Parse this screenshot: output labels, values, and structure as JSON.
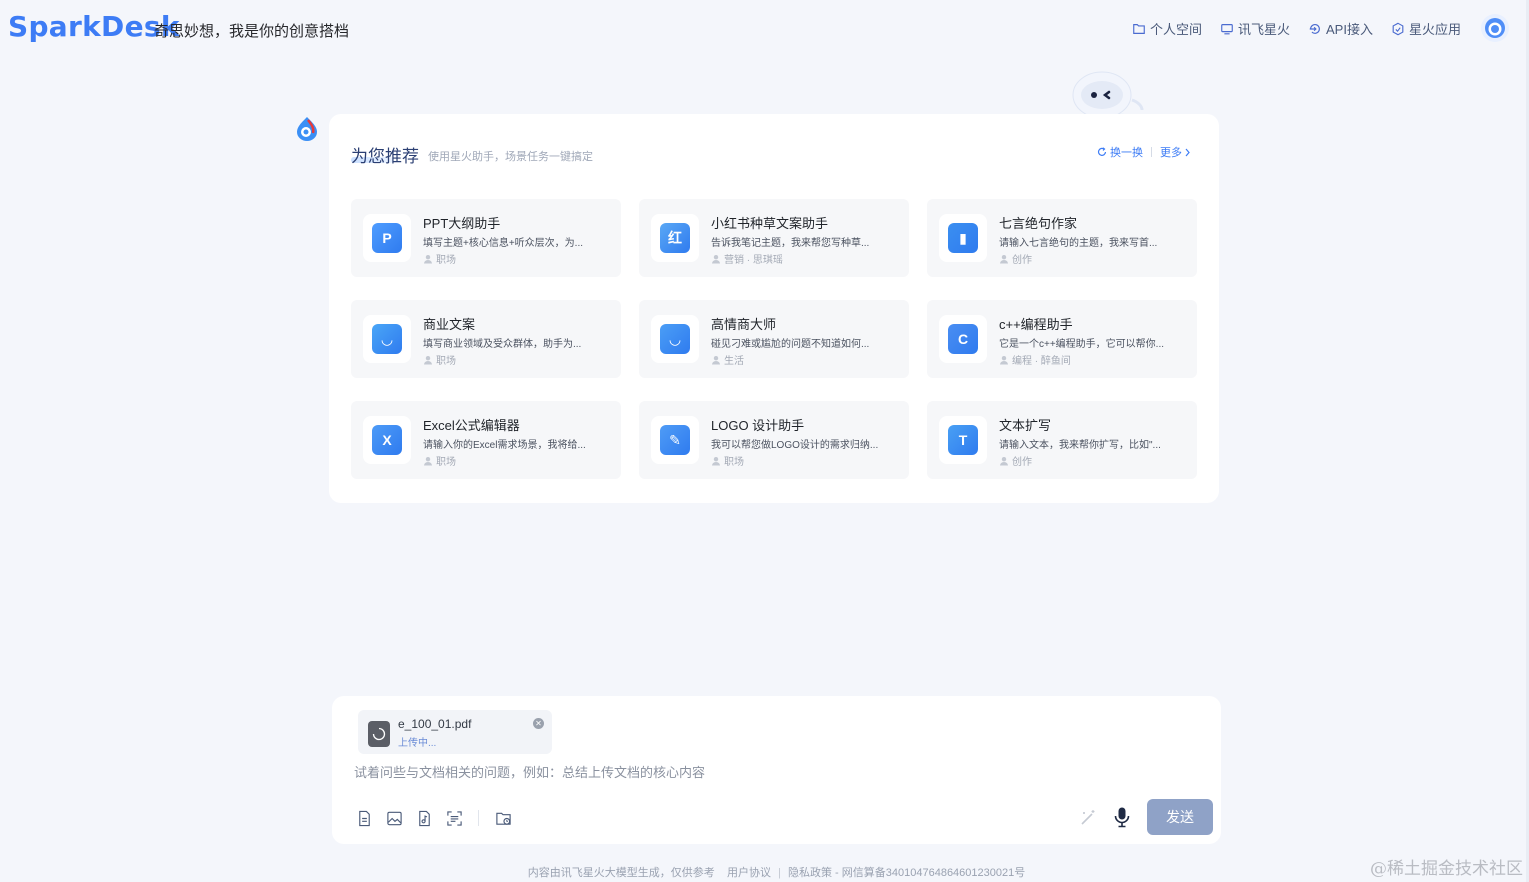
{
  "header": {
    "logo": "SparkDesk",
    "slogan": "奇思妙想，我是你的创意搭档",
    "nav": [
      {
        "label": "个人空间",
        "icon": "folder-icon"
      },
      {
        "label": "讯飞星火",
        "icon": "monitor-icon"
      },
      {
        "label": "API接入",
        "icon": "api-icon"
      },
      {
        "label": "星火应用",
        "icon": "app-icon"
      }
    ]
  },
  "recommend": {
    "title": "为您推荐",
    "subtitle": "使用星火助手，场景任务一键搞定",
    "refresh": "换一换",
    "more": "更多",
    "agents": [
      {
        "name": "PPT大纲助手",
        "desc": "填写主题+核心信息+听众层次，为...",
        "tags": "职场",
        "icon": "ppt-icon",
        "color": "#4f9dff",
        "glyph": "P"
      },
      {
        "name": "小红书种草文案助手",
        "desc": "告诉我笔记主题，我来帮您写种草...",
        "tags": "营销 · 思琪瑶",
        "icon": "xiaohongshu-icon",
        "color": "#5aa8f5",
        "glyph": "红"
      },
      {
        "name": "七言绝句作家",
        "desc": "请输入七言绝句的主题，我来写首...",
        "tags": "创作",
        "icon": "book-icon",
        "color": "#3b8ff0",
        "glyph": "▮"
      },
      {
        "name": "商业文案",
        "desc": "填写商业领域及受众群体，助手为...",
        "tags": "职场",
        "icon": "shopping-bag-icon",
        "color": "#4aa6f7",
        "glyph": "◡"
      },
      {
        "name": "高情商大师",
        "desc": "碰见刁难或尴尬的问题不知道如何...",
        "tags": "生活",
        "icon": "smile-icon",
        "color": "#4b9ef6",
        "glyph": "◡"
      },
      {
        "name": "c++编程助手",
        "desc": "它是一个c++编程助手，它可以帮你...",
        "tags": "编程 · 醉鱼间",
        "icon": "cpp-icon",
        "color": "#4a8ef2",
        "glyph": "C"
      },
      {
        "name": "Excel公式编辑器",
        "desc": "请输入你的Excel需求场景，我将给...",
        "tags": "职场",
        "icon": "excel-icon",
        "color": "#4d9bf7",
        "glyph": "X"
      },
      {
        "name": "LOGO 设计助手",
        "desc": "我可以帮您做LOGO设计的需求归纳...",
        "tags": "职场",
        "icon": "ruler-pencil-icon",
        "color": "#4f9cf6",
        "glyph": "✎"
      },
      {
        "name": "文本扩写",
        "desc": "请输入文本，我来帮你扩写，比如\"...",
        "tags": "创作",
        "icon": "text-icon",
        "color": "#49a0f4",
        "glyph": "T"
      }
    ]
  },
  "input": {
    "file_name": "e_100_01.pdf",
    "file_status": "上传中...",
    "placeholder": "试着问些与文档相关的问题，例如：总结上传文档的核心内容",
    "send": "发送"
  },
  "footer": {
    "notice": "内容由讯飞星火大模型生成，仅供参考",
    "agreement": "用户协议",
    "privacy": "隐私政策",
    "record": "网信算备340104764864601230021号"
  },
  "watermark": "@稀土掘金技术社区"
}
